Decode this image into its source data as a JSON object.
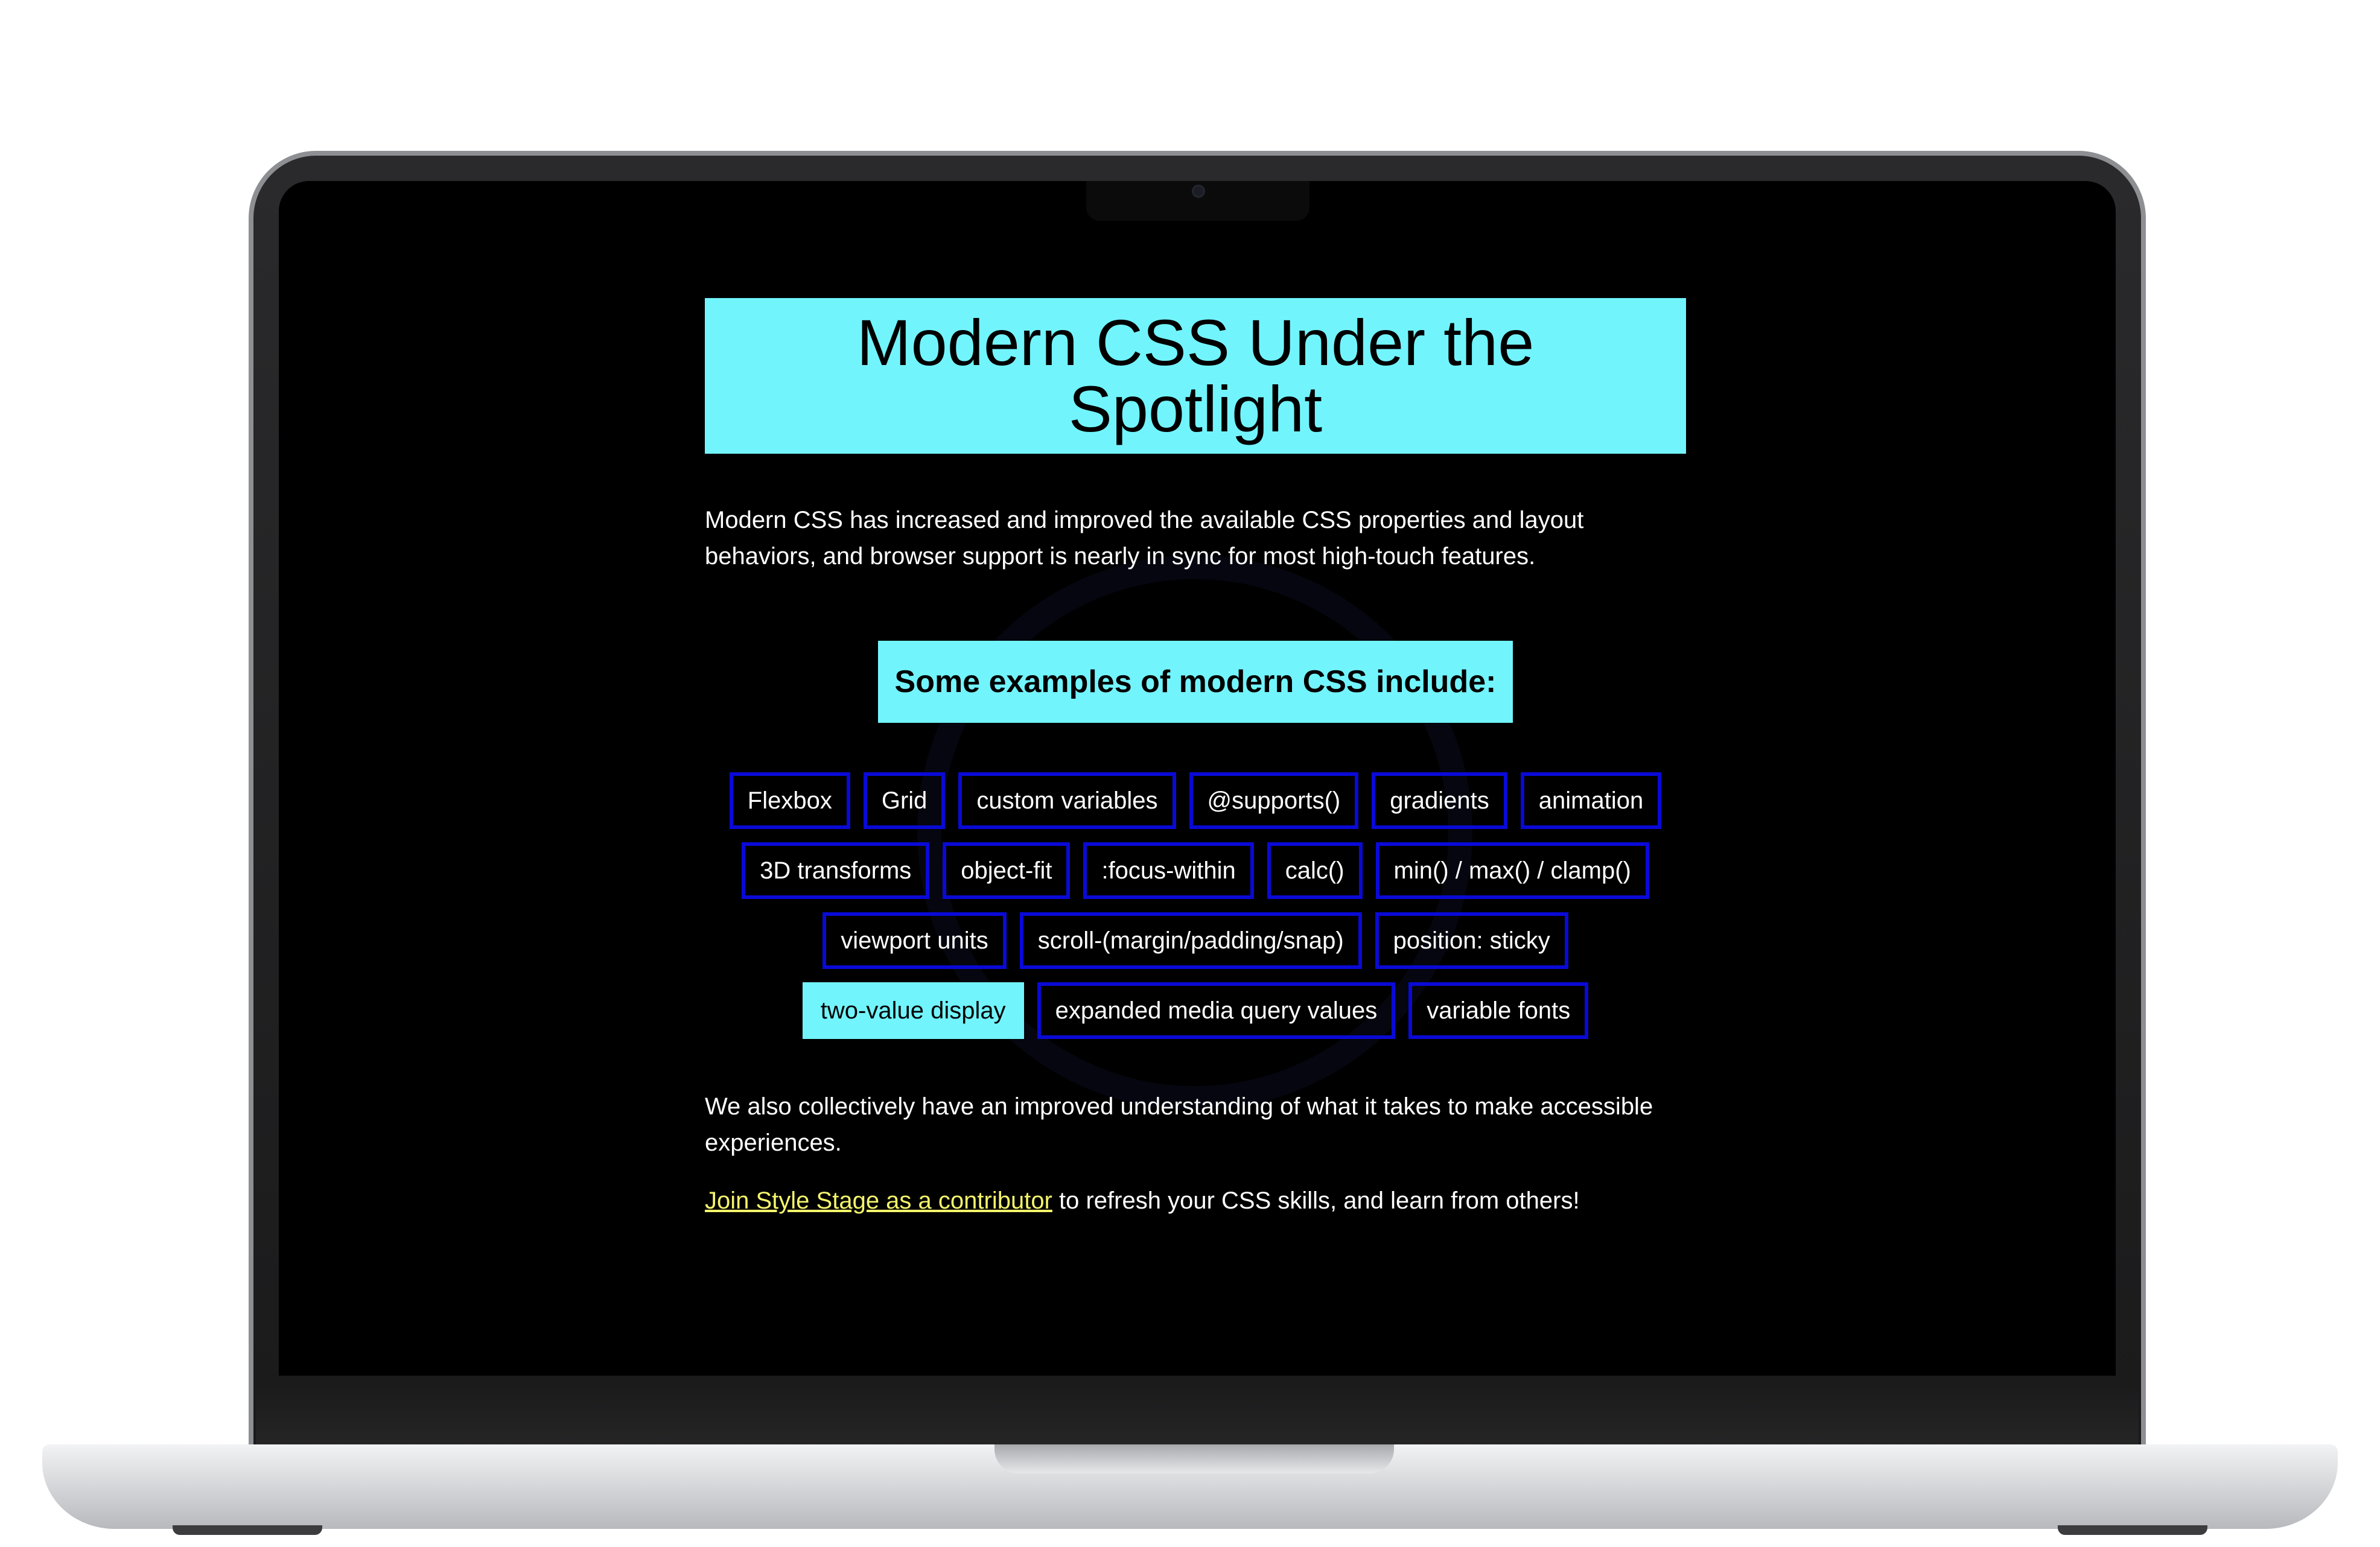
{
  "hero": {
    "title": "Modern CSS Under the Spotlight"
  },
  "intro": "Modern CSS has increased and improved the available CSS properties and layout behaviors, and browser support is nearly in sync for most high-touch features.",
  "examples": {
    "heading": "Some examples of modern CSS include:",
    "tags": [
      "Flexbox",
      "Grid",
      "custom variables",
      "@supports()",
      "gradients",
      "animation",
      "3D transforms",
      "object-fit",
      ":focus-within",
      "calc()",
      "min() / max() / clamp()",
      "viewport units",
      "scroll-(margin/padding/snap)",
      "position: sticky",
      "two-value display",
      "expanded media query values",
      "variable fonts"
    ],
    "active_tag": "two-value display"
  },
  "outro": "We also collectively have an improved understanding of what it takes to make accessible experiences.",
  "cta": {
    "link_text": "Join Style Stage as a contributor",
    "rest_text": " to refresh your CSS skills, and learn from others!"
  },
  "colors": {
    "accent": "#72f4fd",
    "tag_border": "#0a0ad6",
    "link": "#f4f56b",
    "background": "#000000"
  }
}
